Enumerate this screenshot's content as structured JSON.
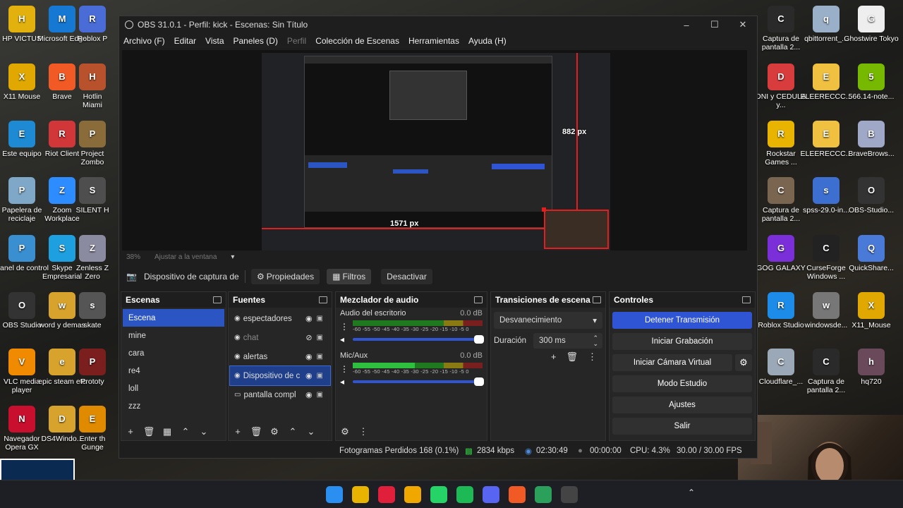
{
  "desktop_icons_left": [
    {
      "label": "HP VICTUS",
      "color": "#e2b10d"
    },
    {
      "label": "Microsoft Edge",
      "color": "#1579d3"
    },
    {
      "label": "Roblox P",
      "color": "#4a6cd6"
    },
    {
      "label": "X11 Mouse",
      "color": "#e0a800"
    },
    {
      "label": "Brave",
      "color": "#f15a24"
    },
    {
      "label": "Hotlin Miami",
      "color": "#b8522c"
    },
    {
      "label": "Este equipo",
      "color": "#1d8ad3"
    },
    {
      "label": "Riot Client",
      "color": "#d13639"
    },
    {
      "label": "Project Zombo",
      "color": "#8a6b3a"
    },
    {
      "label": "Papelera de reciclaje",
      "color": "#7fa7c8"
    },
    {
      "label": "Zoom Workplace",
      "color": "#2d8cff"
    },
    {
      "label": "SILENT H",
      "color": "#4e4e4e"
    },
    {
      "label": "Panel de control",
      "color": "#3a8fd0"
    },
    {
      "label": "Skype Empresarial",
      "color": "#1ea0e0"
    },
    {
      "label": "Zenless Z Zero",
      "color": "#8a8aa0"
    },
    {
      "label": "OBS Studio",
      "color": "#333333"
    },
    {
      "label": "word y demas",
      "color": "#d8a32c"
    },
    {
      "label": "skate",
      "color": "#555555"
    },
    {
      "label": "VLC media player",
      "color": "#f08a00"
    },
    {
      "label": "epic steam etc",
      "color": "#d8a32c"
    },
    {
      "label": "Prototy",
      "color": "#7a1e1e"
    },
    {
      "label": "Navegador Opera GX",
      "color": "#c8102e"
    },
    {
      "label": "DS4Windo...",
      "color": "#d8a32c"
    },
    {
      "label": "Enter th Gunge",
      "color": "#e08a00"
    }
  ],
  "desktop_icons_right": [
    {
      "label": "Captura de pantalla 2...",
      "color": "#2a2a2a"
    },
    {
      "label": "qbittorrent_...",
      "color": "#9ab0c8"
    },
    {
      "label": "Ghostwire Tokyo",
      "color": "#eeeeee"
    },
    {
      "label": "DNI y CEDULA y...",
      "color": "#d93c3c"
    },
    {
      "label": "ELEERECCC...",
      "color": "#f0c040"
    },
    {
      "label": "566.14-note...",
      "color": "#76b900"
    },
    {
      "label": "Rockstar Games ...",
      "color": "#e8b400"
    },
    {
      "label": "ELEERECCC...",
      "color": "#f0c040"
    },
    {
      "label": "BraveBrows...",
      "color": "#a0a8c8"
    },
    {
      "label": "Captura de pantalla 2...",
      "color": "#7a6650"
    },
    {
      "label": "spss-29.0-in...",
      "color": "#3c6fd0"
    },
    {
      "label": "OBS-Studio...",
      "color": "#333333"
    },
    {
      "label": "GOG GALAXY",
      "color": "#7a2fd8"
    },
    {
      "label": "CurseForge Windows ...",
      "color": "#222222"
    },
    {
      "label": "QuickShare...",
      "color": "#4a7ad8"
    },
    {
      "label": "Roblox Studio",
      "color": "#1c8ce8"
    },
    {
      "label": "windowsde...",
      "color": "#777777"
    },
    {
      "label": "X11_Mouse",
      "color": "#e0a800"
    },
    {
      "label": "Cloudflare_...",
      "color": "#9aa8b8"
    },
    {
      "label": "Captura de pantalla 2...",
      "color": "#2a2a2a"
    },
    {
      "label": "hq720",
      "color": "#6a4a5a"
    }
  ],
  "window": {
    "title": "OBS 31.0.1 - Perfil: kick - Escenas: Sin Título",
    "menu": [
      "Archivo (F)",
      "Editar",
      "Vista",
      "Paneles (D)",
      "Perfil",
      "Colección de Escenas",
      "Herramientas",
      "Ayuda (H)"
    ]
  },
  "preview": {
    "zoom": "38%",
    "fit_label": "Ajustar a la ventana",
    "width_label": "1571 px",
    "height_label": "882 px"
  },
  "source_toolbar": {
    "selected_source": "Dispositivo de captura de v",
    "properties": "Propiedades",
    "filters": "Filtros",
    "deactivate": "Desactivar"
  },
  "scenes": {
    "title": "Escenas",
    "items": [
      "Escena",
      "mine",
      "cara",
      "re4",
      "loll",
      "zzz"
    ],
    "selected": 0
  },
  "sources": {
    "title": "Fuentes",
    "items": [
      {
        "name": "espectadores",
        "visible": true
      },
      {
        "name": "chat",
        "visible": false
      },
      {
        "name": "alertas",
        "visible": true
      },
      {
        "name": "Dispositivo de c",
        "visible": true
      },
      {
        "name": "pantalla compl",
        "visible": true
      }
    ],
    "selected": 3
  },
  "mixer": {
    "title": "Mezclador de audio",
    "tracks": [
      {
        "name": "Audio del escritorio",
        "db": "0.0 dB",
        "level": 0.0,
        "volume": 1.0
      },
      {
        "name": "Mic/Aux",
        "db": "0.0 dB",
        "level": 0.48,
        "volume": 1.0
      }
    ],
    "scale": "-60 -55 -50 -45 -40 -35 -30 -25 -20 -15 -10 -5 0"
  },
  "transitions": {
    "title": "Transiciones de escena",
    "selected": "Desvanecimiento",
    "duration_label": "Duración",
    "duration_value": "300 ms"
  },
  "controls": {
    "title": "Controles",
    "buttons": [
      "Detener Transmisión",
      "Iniciar Grabación",
      "Iniciar Cámara Virtual",
      "Modo Estudio",
      "Ajustes",
      "Salir"
    ]
  },
  "status": {
    "dropped": "Fotogramas Perdidos 168 (0.1%)",
    "bitrate": "2834 kbps",
    "stream_time": "02:30:49",
    "rec_time": "00:00:00",
    "cpu": "CPU: 4.3%",
    "fps": "30.00 / 30.00 FPS"
  },
  "taskbar_apps": [
    {
      "name": "windows",
      "color": "#2a8ff0"
    },
    {
      "name": "files",
      "color": "#e8b400"
    },
    {
      "name": "app-red",
      "color": "#e0203a"
    },
    {
      "name": "x11",
      "color": "#f0a800"
    },
    {
      "name": "whatsapp",
      "color": "#25d366"
    },
    {
      "name": "spotify",
      "color": "#1db954"
    },
    {
      "name": "discord",
      "color": "#5865f2"
    },
    {
      "name": "brave",
      "color": "#f15a24"
    },
    {
      "name": "app-green",
      "color": "#2aa05a"
    },
    {
      "name": "obs",
      "color": "#444444"
    }
  ]
}
